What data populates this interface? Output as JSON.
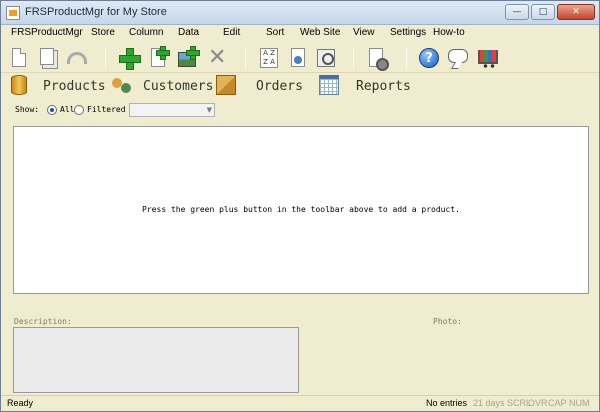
{
  "window": {
    "title": "FRSProductMgr for My Store"
  },
  "menu": [
    "FRSProductMgr",
    "Store",
    "Column",
    "Data",
    "Edit",
    "Sort",
    "Web Site",
    "View",
    "Settings",
    "How-to"
  ],
  "toolbar": {
    "icons": [
      "new-page",
      "copy-pages",
      "undo",
      "add-product",
      "add-variant",
      "add-photo",
      "delete",
      "sort",
      "web-page",
      "search-preview",
      "settings",
      "help",
      "chat",
      "shopping-cart"
    ],
    "help_glyph": "?",
    "delete_glyph": "✕",
    "sort_glyph": "A Z Z A"
  },
  "tabs": [
    {
      "label": "Products",
      "icon": "database-icon"
    },
    {
      "label": "Customers",
      "icon": "people-icon"
    },
    {
      "label": "Orders",
      "icon": "box-icon"
    },
    {
      "label": "Reports",
      "icon": "calendar-icon"
    }
  ],
  "filter": {
    "show_label": "Show:",
    "all_label": "All",
    "filtered_label": "Filtered",
    "selected": "all",
    "dropdown_value": ""
  },
  "list": {
    "empty_message": "Press the green plus button in the toolbar above to add a product."
  },
  "description": {
    "label": "Description:"
  },
  "photo": {
    "label": "Photo:"
  },
  "status": {
    "ready": "Ready",
    "entries": "No entries",
    "days": "21 days",
    "scrl": "SCRL",
    "ovr": "OVR",
    "caps": "CAP",
    "num": "NUM"
  }
}
